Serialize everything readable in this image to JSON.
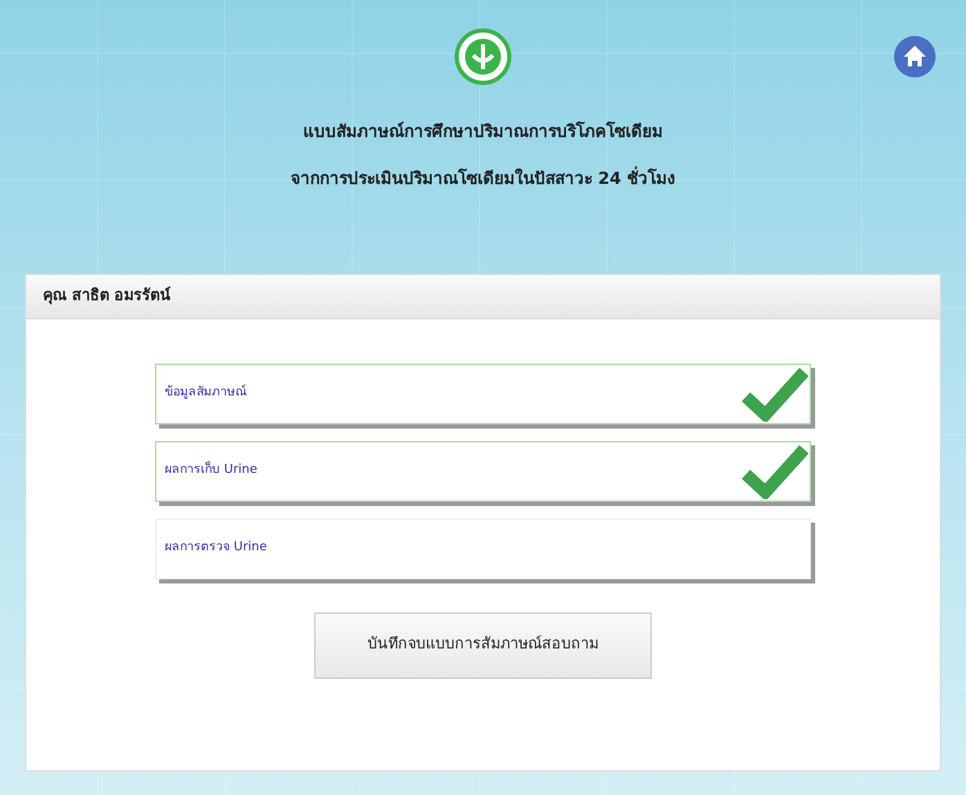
{
  "header": {
    "title": "แบบสัมภาษณ์การศึกษาปริมาณการบริโภคโซเดียม",
    "subtitle": "จากการประเมินปริมาณโซเดียมในปัสสาวะ 24 ชั่วโมง"
  },
  "panel": {
    "person": "คุณ สาธิต อมรรัตน์",
    "items": [
      {
        "label": "ข้อมูลสัมภาษณ์",
        "done": true
      },
      {
        "label": "ผลการเก็บ Urine",
        "done": true
      },
      {
        "label": "ผลการตรวจ Urine",
        "done": false
      }
    ],
    "save_button": "บันทึกจบแบบการสัมภาษณ์สอบถาม"
  }
}
